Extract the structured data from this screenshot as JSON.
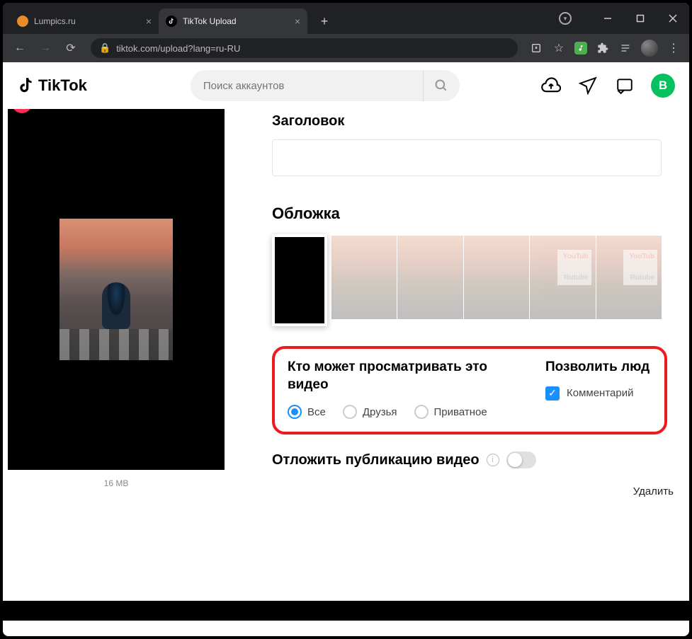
{
  "window": {
    "tabs": [
      {
        "title": "Lumpics.ru",
        "active": false
      },
      {
        "title": "TikTok Upload",
        "active": true
      }
    ],
    "url": "tiktok.com/upload?lang=ru-RU"
  },
  "tiktok_header": {
    "brand": "TikTok",
    "search_placeholder": "Поиск аккаунтов",
    "avatar_letter": "В"
  },
  "upload": {
    "file_size": "16 MB",
    "title_label": "Заголовок",
    "title_value": "",
    "cover_label": "Обложка",
    "cover_watermarks": {
      "youtube": "YouTub",
      "rutube": "Rutube"
    },
    "privacy": {
      "heading": "Кто может просматривать это видео",
      "options": [
        {
          "label": "Все",
          "checked": true
        },
        {
          "label": "Друзья",
          "checked": false
        },
        {
          "label": "Приватное",
          "checked": false
        }
      ]
    },
    "allow": {
      "heading": "Позволить люд",
      "comment_label": "Комментарий",
      "comment_checked": true
    },
    "schedule": {
      "label": "Отложить публикацию видео",
      "enabled": false
    },
    "delete_label": "Удалить"
  }
}
